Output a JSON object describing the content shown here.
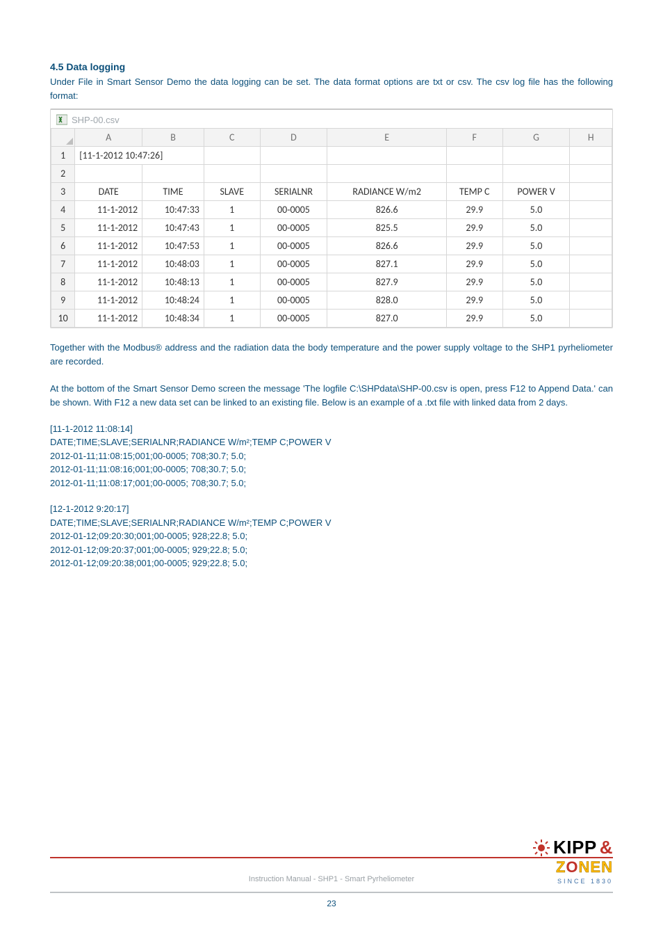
{
  "section": {
    "heading": "4.5 Data logging"
  },
  "para1": "Under File in Smart Sensor Demo the data logging can be set. The data format options are txt or csv. The csv log file has the following format:",
  "sheet": {
    "filename": "SHP-00.csv",
    "column_letters": [
      "A",
      "B",
      "C",
      "D",
      "E",
      "F",
      "G",
      "H"
    ],
    "row_numbers": [
      "1",
      "2",
      "3",
      "4",
      "5",
      "6",
      "7",
      "8",
      "9",
      "10"
    ],
    "rows": [
      {
        "a": "[11-1-2012 10:47:26]",
        "b": "",
        "c": "",
        "d": "",
        "e": "",
        "f": "",
        "g": "",
        "h": ""
      },
      {
        "a": "",
        "b": "",
        "c": "",
        "d": "",
        "e": "",
        "f": "",
        "g": "",
        "h": ""
      },
      {
        "a": "DATE",
        "b": "TIME",
        "c": "SLAVE",
        "d": "SERIALNR",
        "e": "RADIANCE W/m2",
        "f": "TEMP C",
        "g": "POWER V",
        "h": ""
      },
      {
        "a": "11-1-2012",
        "b": "10:47:33",
        "c": "1",
        "d": "00-0005",
        "e": "826.6",
        "f": "29.9",
        "g": "5.0",
        "h": ""
      },
      {
        "a": "11-1-2012",
        "b": "10:47:43",
        "c": "1",
        "d": "00-0005",
        "e": "825.5",
        "f": "29.9",
        "g": "5.0",
        "h": ""
      },
      {
        "a": "11-1-2012",
        "b": "10:47:53",
        "c": "1",
        "d": "00-0005",
        "e": "826.6",
        "f": "29.9",
        "g": "5.0",
        "h": ""
      },
      {
        "a": "11-1-2012",
        "b": "10:48:03",
        "c": "1",
        "d": "00-0005",
        "e": "827.1",
        "f": "29.9",
        "g": "5.0",
        "h": ""
      },
      {
        "a": "11-1-2012",
        "b": "10:48:13",
        "c": "1",
        "d": "00-0005",
        "e": "827.9",
        "f": "29.9",
        "g": "5.0",
        "h": ""
      },
      {
        "a": "11-1-2012",
        "b": "10:48:24",
        "c": "1",
        "d": "00-0005",
        "e": "828.0",
        "f": "29.9",
        "g": "5.0",
        "h": ""
      },
      {
        "a": "11-1-2012",
        "b": "10:48:34",
        "c": "1",
        "d": "00-0005",
        "e": "827.0",
        "f": "29.9",
        "g": "5.0",
        "h": ""
      }
    ]
  },
  "para2": "Together with the Modbus® address and the radiation data the body temperature and the power supply voltage to the SHP1 pyrheliometer are recorded.",
  "para3": "At the bottom of the Smart Sensor Demo screen the message 'The logfile C:\\SHPdata\\SHP-00.csv is open, press F12 to Append Data.' can be shown. With F12 a new data set can be linked to an existing file. Below is an example of a .txt file with linked data from 2 days.",
  "log1": {
    "stamp": "[11-1-2012 11:08:14]",
    "header": "DATE;TIME;SLAVE;SERIALNR;RADIANCE W/m²;TEMP C;POWER V",
    "l1": "2012-01-11;11:08:15;001;00-0005; 708;30.7; 5.0;",
    "l2": "2012-01-11;11:08:16;001;00-0005; 708;30.7; 5.0;",
    "l3": "2012-01-11;11:08:17;001;00-0005; 708;30.7; 5.0;"
  },
  "log2": {
    "stamp": "[12-1-2012 9:20:17]",
    "header": "DATE;TIME;SLAVE;SERIALNR;RADIANCE W/m²;TEMP C;POWER V",
    "l1": "2012-01-12;09:20:30;001;00-0005; 928;22.8; 5.0;",
    "l2": "2012-01-12;09:20:37;001;00-0005; 929;22.8; 5.0;",
    "l3": "2012-01-12;09:20:38;001;00-0005; 929;22.8; 5.0;"
  },
  "footer": {
    "caption": "Instruction Manual - SHP1 - Smart Pyrheliometer",
    "page": "23",
    "logo1a": "KIPP",
    "logo1b": "&",
    "logo2a": "Z",
    "logo2b": "O",
    "logo2c": "NEN",
    "logo3": "SINCE 1830"
  }
}
